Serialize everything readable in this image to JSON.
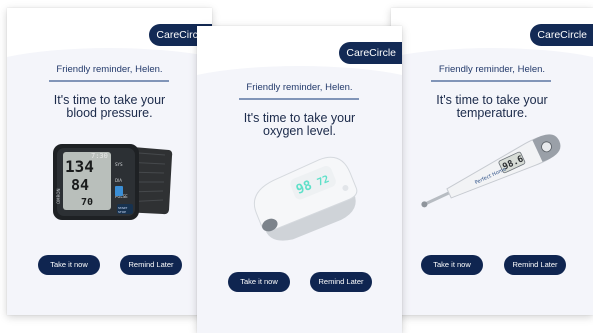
{
  "brand": {
    "name": "CareCircle",
    "color": "#132a55"
  },
  "cards": [
    {
      "greeting": "Friendly reminder, Helen.",
      "prompt_line1": "It's time to take your",
      "prompt_line2": "blood pressure.",
      "device_icon": "blood-pressure-monitor-icon",
      "monitor": {
        "brand": "OMRON",
        "systolic": "134",
        "diastolic": "84",
        "pulse": "70",
        "time": "7:30",
        "sys_label": "SYS",
        "dia_label": "DIA",
        "pulse_label": "PULSE",
        "start_label": "START",
        "stop_label": "STOP"
      },
      "primary_button": "Take it now",
      "secondary_button": "Remind Later"
    },
    {
      "greeting": "Friendly reminder, Helen.",
      "prompt_line1": "It's time to take your",
      "prompt_line2": "oxygen level.",
      "device_icon": "pulse-oximeter-icon",
      "oximeter": {
        "spo2": "98",
        "pulse": "72"
      },
      "primary_button": "Take it now",
      "secondary_button": "Remind Later"
    },
    {
      "greeting": "Friendly reminder, Helen.",
      "prompt_line1": "It's time to take your",
      "prompt_line2": "temperature.",
      "device_icon": "digital-thermometer-icon",
      "thermometer": {
        "reading": "98.6",
        "brand": "Perfect Home"
      },
      "primary_button": "Take it now",
      "secondary_button": "Remind Later"
    }
  ],
  "colors": {
    "background": "#f4f5fa",
    "button": "#0f2550",
    "divider": "#8195b8",
    "text": "#1b2a4a",
    "oximeter_display": "#5fe0c9"
  }
}
